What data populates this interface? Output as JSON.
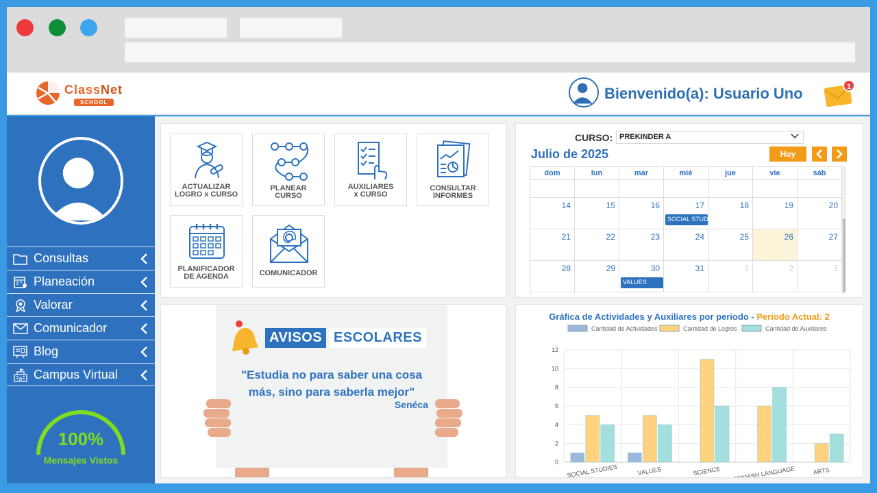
{
  "header": {
    "logo_text_a": "Class",
    "logo_text_b": "Net",
    "logo_school": "SCHOOL",
    "welcome": "Bienvenido(a): Usuario Uno",
    "mail_badge": "1"
  },
  "sidebar": {
    "items": [
      {
        "label": "Consultas",
        "icon": "folder-icon"
      },
      {
        "label": "Planeación",
        "icon": "calendar-settings-icon"
      },
      {
        "label": "Valorar",
        "icon": "award-icon"
      },
      {
        "label": "Comunicador",
        "icon": "envelope-icon"
      },
      {
        "label": "Blog",
        "icon": "blog-icon"
      },
      {
        "label": "Campus Virtual",
        "icon": "school-building-icon"
      }
    ],
    "gauge_value": 1.0,
    "gauge_pct": "100%",
    "gauge_label": "Mensajes Vistos"
  },
  "tiles": [
    {
      "label_l1": "ACTUALIZAR",
      "label_l2": "LOGRO x CURSO",
      "icon": "graduate-icon"
    },
    {
      "label_l1": "PLANEAR",
      "label_l2": "CURSO",
      "icon": "flow-icon"
    },
    {
      "label_l1": "AUXILIARES",
      "label_l2": "x CURSO",
      "icon": "checklist-icon"
    },
    {
      "label_l1": "CONSULTAR",
      "label_l2": "INFORMES",
      "icon": "report-icon"
    },
    {
      "label_l1": "PLANIFICADOR",
      "label_l2": "DE AGENDA",
      "icon": "calendar-icon"
    },
    {
      "label_l1": "",
      "label_l2": "COMUNICADOR",
      "icon": "mail-at-icon"
    }
  ],
  "calendar": {
    "curso_label": "CURSO:",
    "curso_value": "PREKINDER A",
    "month": "Julio de 2025",
    "today_label": "Hoy",
    "weekdays": [
      "dom",
      "lun",
      "mar",
      "mié",
      "jue",
      "vie",
      "sáb"
    ],
    "weeks": [
      [
        "",
        "",
        "",
        "",
        "",
        "",
        ""
      ],
      [
        "14",
        "15",
        "16",
        "17",
        "18",
        "19",
        "20"
      ],
      [
        "21",
        "22",
        "23",
        "24",
        "25",
        "26",
        "27"
      ],
      [
        "28",
        "29",
        "30",
        "31",
        "1",
        "2",
        "3"
      ]
    ],
    "events": [
      {
        "week": 1,
        "day": 3,
        "label": "SOCIAL STUDIES"
      },
      {
        "week": 3,
        "day": 2,
        "label": "VALUES"
      }
    ],
    "today": {
      "week": 2,
      "day": 5
    }
  },
  "avisos": {
    "title_a": "AVISOS",
    "title_b": "ESCOLARES",
    "quote_l1": "\"Estudia no para saber una cosa",
    "quote_l2": "más, sino para saberla mejor\"",
    "author": "Senéca"
  },
  "chart_title": {
    "main": "Gráfica de Actividades y Auxiliares por periodo - ",
    "period": "Periodo Actual: 2"
  },
  "chart_data": {
    "type": "bar",
    "categories": [
      "SOCIAL STUDIES",
      "VALUES",
      "SCIENCE",
      "SPANISH LANGUAGE",
      "ARTS"
    ],
    "series": [
      {
        "name": "Cantidad de Actividades",
        "values": [
          1,
          1,
          0,
          0,
          0
        ],
        "color": "#9bb7dd"
      },
      {
        "name": "Cantidad de Logros",
        "values": [
          5,
          5,
          11,
          6,
          2
        ],
        "color": "#ffd280"
      },
      {
        "name": "Cantidad de Auxiliares",
        "values": [
          4,
          4,
          6,
          8,
          3
        ],
        "color": "#a3dfdf"
      }
    ],
    "yticks": [
      0,
      2,
      4,
      6,
      8,
      10,
      12
    ],
    "ylim": [
      0,
      12
    ],
    "grid": true,
    "legend": "top"
  }
}
